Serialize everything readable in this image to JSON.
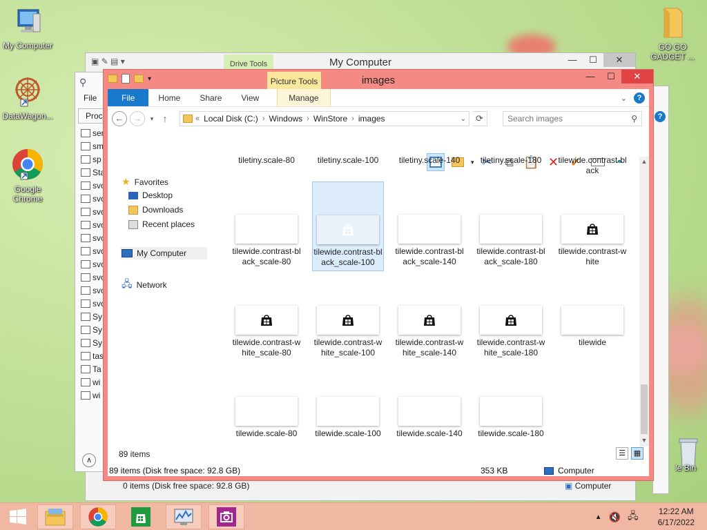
{
  "desktop": {
    "icons": [
      {
        "label": "My Computer"
      },
      {
        "label": "DataWagon..."
      },
      {
        "label": "Google Chrome"
      },
      {
        "label": "GO GO GADGET ..."
      },
      {
        "label": "le Bin"
      }
    ]
  },
  "back_window": {
    "title": "My Computer",
    "context_tab": "Drive Tools",
    "status_items": "0 items (Disk free space: 92.8 GB)",
    "status_location": "Computer"
  },
  "process_window": {
    "tabs": [
      "File",
      "Proce"
    ],
    "items": [
      "ser",
      "sm",
      "sp",
      "Sta",
      "svc",
      "svc",
      "svc",
      "svc",
      "svc",
      "svc",
      "svc",
      "svc",
      "svc",
      "svc",
      "Sy",
      "Sy",
      "Sy",
      "tas",
      "Ta",
      "wi",
      "wi"
    ]
  },
  "explorer": {
    "title": "images",
    "context_tab": "Picture Tools",
    "ribbon_tabs": {
      "file": "File",
      "home": "Home",
      "share": "Share",
      "view": "View",
      "manage": "Manage"
    },
    "breadcrumb": {
      "overflow": "«",
      "c1": "Local Disk (C:)",
      "c2": "Windows",
      "c3": "WinStore",
      "c4": "images"
    },
    "search_placeholder": "Search images",
    "nav": {
      "favorites": "Favorites",
      "desktop": "Desktop",
      "downloads": "Downloads",
      "recent": "Recent places",
      "computer": "My Computer",
      "network": "Network"
    },
    "files": [
      {
        "name": "tiletiny.scale-80",
        "icon": "none"
      },
      {
        "name": "tiletiny.scale-100",
        "icon": "none"
      },
      {
        "name": "tiletiny.scale-140",
        "icon": "none"
      },
      {
        "name": "tiletiny.scale-180",
        "icon": "none"
      },
      {
        "name": "tilewide.contrast-black",
        "icon": "none"
      },
      {
        "name": "tilewide.contrast-black_scale-80",
        "icon": "none"
      },
      {
        "name": "tilewide.contrast-black_scale-100",
        "icon": "store-white",
        "selected": true
      },
      {
        "name": "tilewide.contrast-black_scale-140",
        "icon": "none"
      },
      {
        "name": "tilewide.contrast-black_scale-180",
        "icon": "none"
      },
      {
        "name": "tilewide.contrast-white",
        "icon": "store-black"
      },
      {
        "name": "tilewide.contrast-white_scale-80",
        "icon": "store-black"
      },
      {
        "name": "tilewide.contrast-white_scale-100",
        "icon": "store-black"
      },
      {
        "name": "tilewide.contrast-white_scale-140",
        "icon": "store-black"
      },
      {
        "name": "tilewide.contrast-white_scale-180",
        "icon": "store-black"
      },
      {
        "name": "tilewide",
        "icon": "none"
      },
      {
        "name": "tilewide.scale-80",
        "icon": "none"
      },
      {
        "name": "tilewide.scale-100",
        "icon": "none"
      },
      {
        "name": "tilewide.scale-140",
        "icon": "none"
      },
      {
        "name": "tilewide.scale-180",
        "icon": "none"
      }
    ],
    "item_count": "89 items",
    "status": {
      "items": "89 items (Disk free space: 92.8 GB)",
      "size": "353 KB",
      "location": "Computer"
    }
  },
  "taskbar": {
    "apps": [
      "start-button",
      "file-explorer",
      "google-chrome",
      "windows-store",
      "performance-monitor",
      "camera-app"
    ],
    "clock": {
      "time": "12:22 AM",
      "date": "6/17/2022"
    }
  },
  "colors": {
    "explorer_frame": "#f58a84",
    "file_tab": "#1979ca",
    "picture_tools": "#fbe79c",
    "drive_tools": "#d7efb6",
    "taskbar": "#f0b7a3"
  }
}
